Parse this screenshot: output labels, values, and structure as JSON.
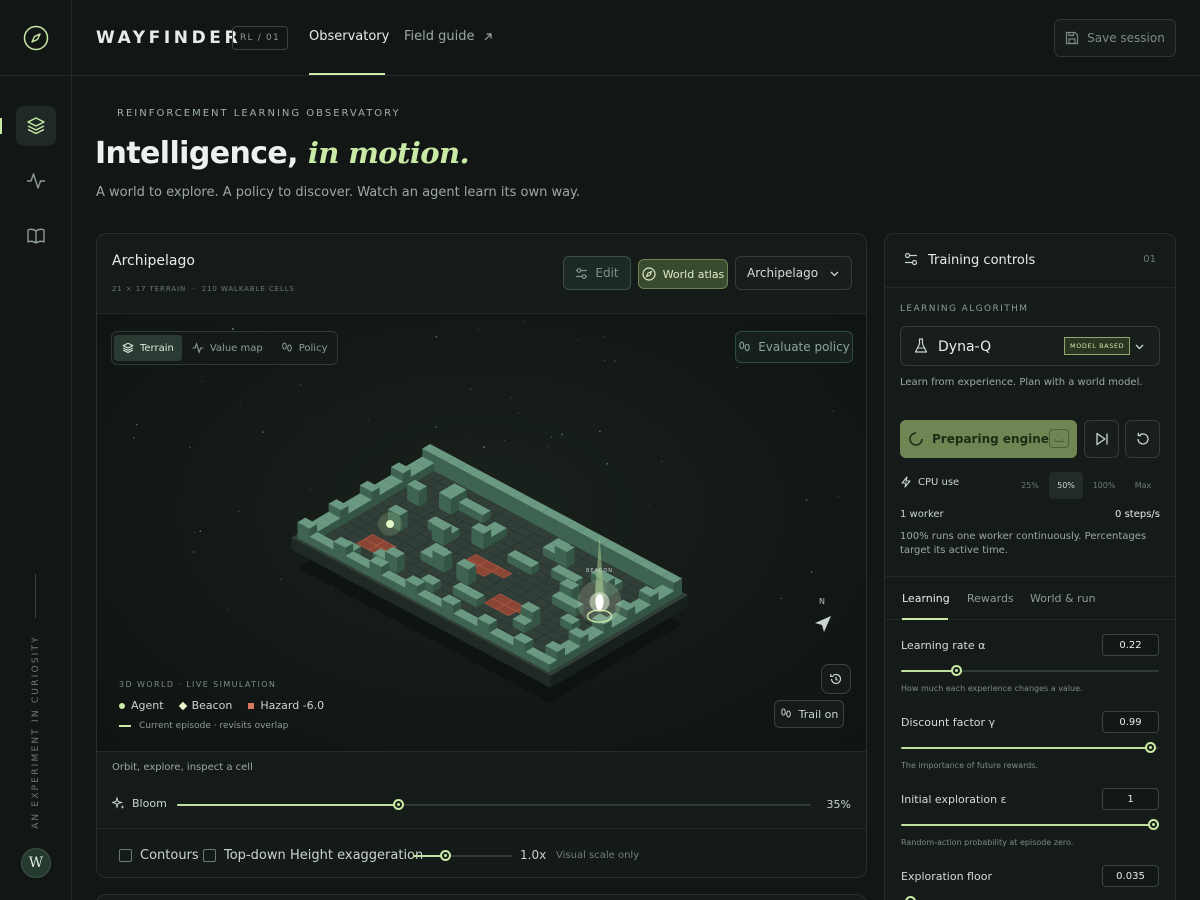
{
  "app": {
    "brand": "WAYFINDER",
    "version": "RL / 01",
    "nav": [
      {
        "label": "Observatory",
        "active": true
      },
      {
        "label": "Field guide",
        "icon": "arrow-up-right-icon"
      }
    ],
    "save_label": "Save session",
    "rail_caption": "AN EXPERIMENT IN CURIOSITY",
    "avatar_initial": "W",
    "rail_items": [
      "layers-icon",
      "activity-icon",
      "book-icon"
    ]
  },
  "hero": {
    "eyebrow": "REINFORCEMENT LEARNING OBSERVATORY",
    "title_plain": "Intelligence,",
    "title_accent": "in motion.",
    "subtitle": "A world to explore. A policy to discover. Watch an agent learn its own way."
  },
  "world": {
    "title": "Archipelago",
    "meta": "21 × 17 TERRAIN  ·  210 WALKABLE CELLS",
    "edit_label": "Edit",
    "atlas_label": "World atlas",
    "selected_world": "Archipelago",
    "view_modes": [
      {
        "label": "Terrain",
        "icon": "layers-icon",
        "active": true
      },
      {
        "label": "Value map",
        "icon": "activity-icon",
        "active": false
      },
      {
        "label": "Policy",
        "icon": "footprints-icon",
        "active": false
      }
    ],
    "evaluate_label": "Evaluate policy",
    "beacon_label": "BEACON",
    "compass": "N",
    "legend_heading": "3D WORLD · LIVE SIMULATION",
    "legend": [
      {
        "label": "Agent",
        "color": "#c9eaa4",
        "shape": "dot"
      },
      {
        "label": "Beacon",
        "color": "#e7f5c9",
        "shape": "diamond"
      },
      {
        "label": "Hazard -6.0",
        "color": "#d77a5f",
        "shape": "square"
      }
    ],
    "trail_legend": "Current episode · revisits overlap",
    "trail_label": "Trail on",
    "hint": "Orbit, explore, inspect a cell",
    "bloom": {
      "label": "Bloom",
      "value": 35,
      "display": "35%"
    },
    "contours_label": "Contours",
    "topdown_label": "Top-down",
    "height": {
      "label": "Height exaggeration",
      "value": 1.0,
      "display": "1.0x",
      "note": "Visual scale only"
    }
  },
  "controls": {
    "title": "Training controls",
    "number": "01",
    "section_label": "LEARNING ALGORITHM",
    "algorithm": "Dyna-Q",
    "algorithm_badge": "MODEL BASED",
    "algorithm_desc": "Learn from experience. Plan with a world model.",
    "prepare_label": "Preparing engine",
    "cpu_label": "CPU use",
    "cpu_options": [
      {
        "label": "25%",
        "active": false
      },
      {
        "label": "50%",
        "active": true
      },
      {
        "label": "100%",
        "active": false
      },
      {
        "label": "Max",
        "active": false
      }
    ],
    "workers": "1 worker",
    "steps": "0 steps/s",
    "cpu_note": "100% runs one worker continuously. Percentages target its active time.",
    "tabs": [
      {
        "label": "Learning",
        "active": true
      },
      {
        "label": "Rewards",
        "active": false
      },
      {
        "label": "World & run",
        "active": false
      }
    ],
    "params": [
      {
        "label": "Learning rate α",
        "value": "0.22",
        "fraction": 0.22,
        "note": "How much each experience changes a value."
      },
      {
        "label": "Discount factor γ",
        "value": "0.99",
        "fraction": 0.99,
        "note": "The importance of future rewards."
      },
      {
        "label": "Initial exploration ε",
        "value": "1",
        "fraction": 1.0,
        "note": "Random-action probability at episode zero."
      },
      {
        "label": "Exploration floor",
        "value": "0.035",
        "fraction": 0.035,
        "note": ""
      }
    ]
  },
  "colors": {
    "accent": "#c9eaa4",
    "background": "#121716",
    "terrain": "#5d8a70",
    "hazard": "#b85c45"
  }
}
